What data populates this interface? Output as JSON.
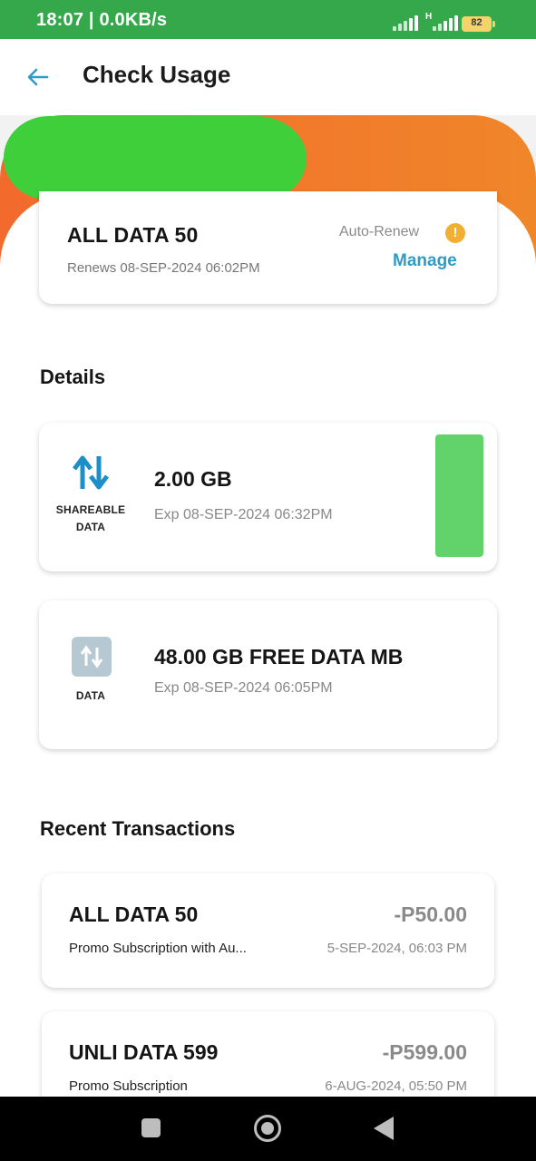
{
  "status_bar": {
    "time": "18:07 | 0.0KB/s",
    "network_type": "H",
    "battery": "82"
  },
  "header": {
    "title": "Check Usage",
    "back_icon": "arrow-left-icon"
  },
  "plan": {
    "name": "ALL DATA 50",
    "renews": "Renews 08-SEP-2024 06:02PM",
    "auto_renew_label": "Auto-Renew",
    "warning_glyph": "!",
    "manage_label": "Manage"
  },
  "details": {
    "title": "Details",
    "items": [
      {
        "icon": "swap-arrows-icon",
        "icon_label": "SHAREABLE DATA",
        "amount": "2.00 GB",
        "expiry": "Exp 08-SEP-2024 06:32PM"
      },
      {
        "icon": "data-icon",
        "icon_label": "DATA",
        "amount": "48.00 GB FREE DATA MB",
        "expiry": "Exp 08-SEP-2024 06:05PM"
      }
    ]
  },
  "transactions": {
    "title": "Recent Transactions",
    "items": [
      {
        "name": "ALL DATA 50",
        "amount": "-P50.00",
        "description": "Promo Subscription with Au...",
        "date": "5-SEP-2024, 06:03 PM"
      },
      {
        "name": "UNLI DATA 599",
        "amount": "-P599.00",
        "description": "Promo Subscription",
        "date": "6-AUG-2024, 05:50 PM"
      }
    ]
  },
  "colors": {
    "status_bar": "#34a84a",
    "hero_orange": "#f26a2c",
    "link_blue": "#2f9bc6",
    "warning": "#f2b033",
    "meter_green": "#62d36a"
  }
}
